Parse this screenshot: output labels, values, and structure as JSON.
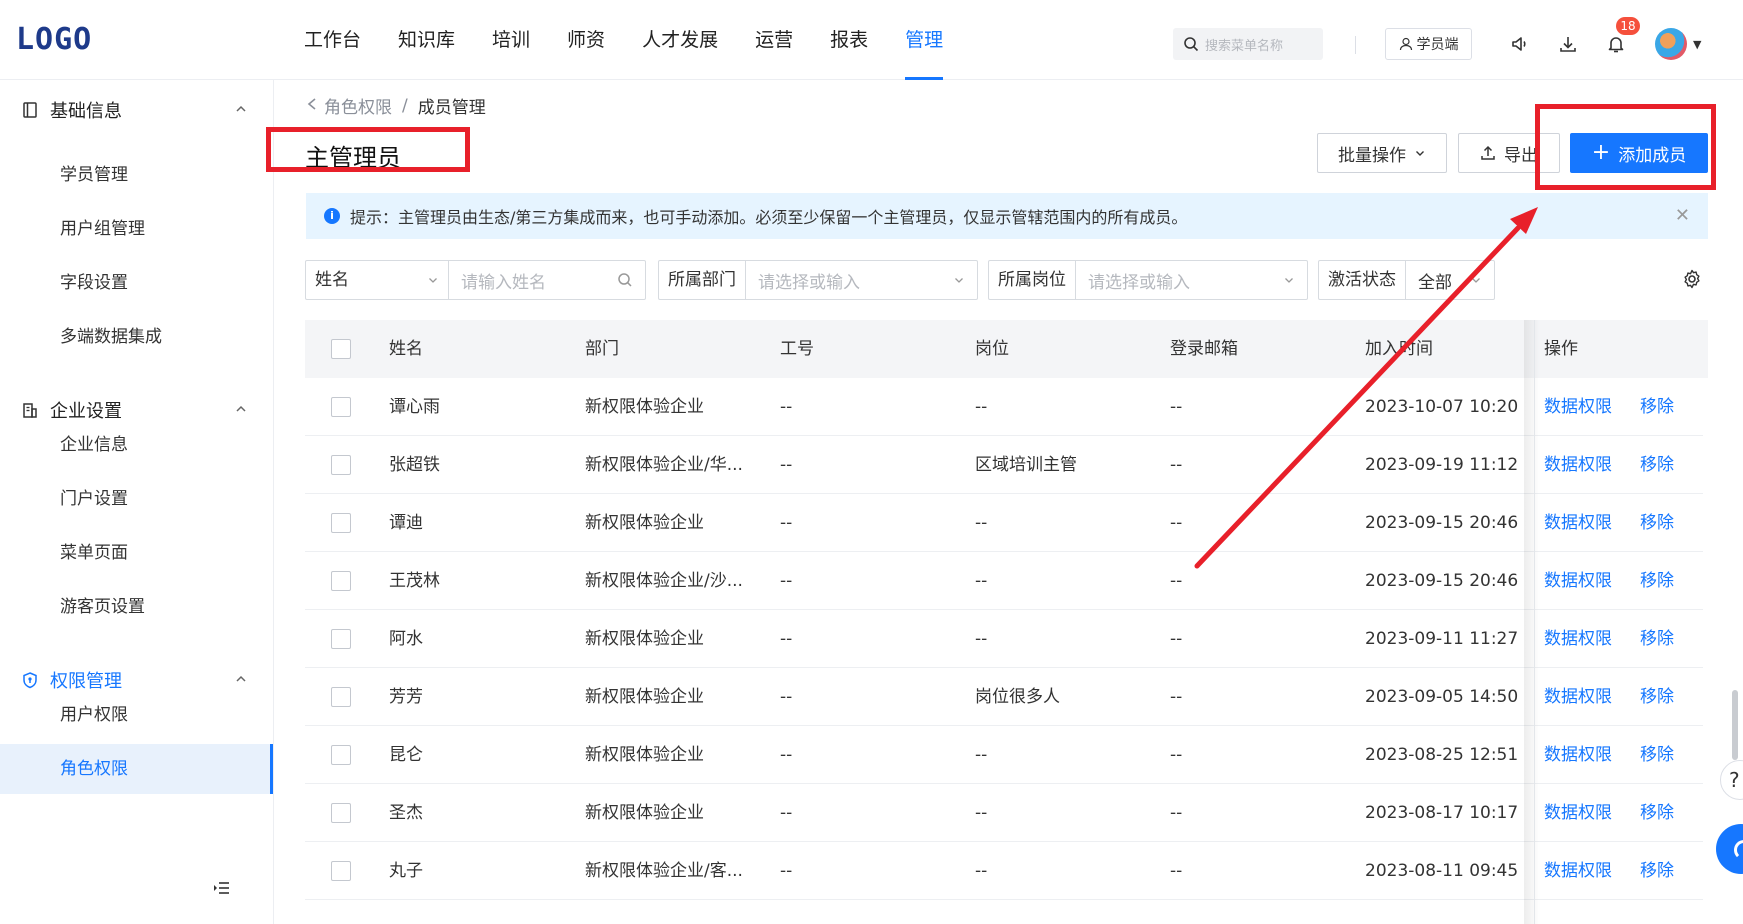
{
  "app": {
    "logo": "LOGO",
    "nav": [
      "工作台",
      "知识库",
      "培训",
      "师资",
      "人才发展",
      "运营",
      "报表",
      "管理"
    ],
    "nav_active": "管理",
    "search_placeholder": "搜索菜单名称",
    "learner_label": "学员端",
    "notification_count": "18",
    "accent_color": "#1677ff"
  },
  "sidebar": {
    "groups": [
      {
        "label": "基础信息",
        "icon": "book-icon",
        "items": [
          "学员管理",
          "用户组管理",
          "字段设置",
          "多端数据集成"
        ]
      },
      {
        "label": "企业设置",
        "icon": "building-icon",
        "items": [
          "企业信息",
          "门户设置",
          "菜单页面",
          "游客页设置"
        ]
      },
      {
        "label": "权限管理",
        "icon": "shield-icon",
        "items": [
          "用户权限",
          "角色权限"
        ]
      }
    ],
    "active_item": "角色权限"
  },
  "breadcrumb": {
    "prev": "角色权限",
    "separator": "/",
    "current": "成员管理"
  },
  "page": {
    "title": "主管理员",
    "batch_label": "批量操作",
    "export_label": "导出",
    "add_label": "添加成员",
    "tip": "提示：主管理员由生态/第三方集成而来，也可手动添加。必须至少保留一个主管理员，仅显示管辖范围内的所有成员。"
  },
  "filters": {
    "name": {
      "label": "姓名",
      "placeholder": "请输入姓名"
    },
    "dept": {
      "label": "所属部门",
      "placeholder": "请选择或输入"
    },
    "post": {
      "label": "所属岗位",
      "placeholder": "请选择或输入"
    },
    "status": {
      "label": "激活状态",
      "value": "全部"
    }
  },
  "table": {
    "headers": [
      "姓名",
      "部门",
      "工号",
      "岗位",
      "登录邮箱",
      "加入时间",
      "操作"
    ],
    "action_labels": [
      "数据权限",
      "移除"
    ],
    "rows": [
      {
        "name": "谭心雨",
        "dept": "新权限体验企业",
        "id": "--",
        "post": "--",
        "email": "--",
        "joined": "2023-10-07 10:20"
      },
      {
        "name": "张超铁",
        "dept": "新权限体验企业/华...",
        "id": "--",
        "post": "区域培训主管",
        "email": "--",
        "joined": "2023-09-19 11:12"
      },
      {
        "name": "谭迪",
        "dept": "新权限体验企业",
        "id": "--",
        "post": "--",
        "email": "--",
        "joined": "2023-09-15 20:46"
      },
      {
        "name": "王茂林",
        "dept": "新权限体验企业/沙...",
        "id": "--",
        "post": "--",
        "email": "--",
        "joined": "2023-09-15 20:46"
      },
      {
        "name": "阿水",
        "dept": "新权限体验企业",
        "id": "--",
        "post": "--",
        "email": "--",
        "joined": "2023-09-11 11:27"
      },
      {
        "name": "芳芳",
        "dept": "新权限体验企业",
        "id": "--",
        "post": "岗位很多人",
        "email": "--",
        "joined": "2023-09-05 14:50"
      },
      {
        "name": "昆仑",
        "dept": "新权限体验企业",
        "id": "--",
        "post": "--",
        "email": "--",
        "joined": "2023-08-25 12:51"
      },
      {
        "name": "圣杰",
        "dept": "新权限体验企业",
        "id": "--",
        "post": "--",
        "email": "--",
        "joined": "2023-08-17 10:17"
      },
      {
        "name": "丸子",
        "dept": "新权限体验企业/客...",
        "id": "--",
        "post": "--",
        "email": "--",
        "joined": "2023-08-11 09:45"
      }
    ]
  },
  "annotation": {
    "color": "#e8202a"
  }
}
